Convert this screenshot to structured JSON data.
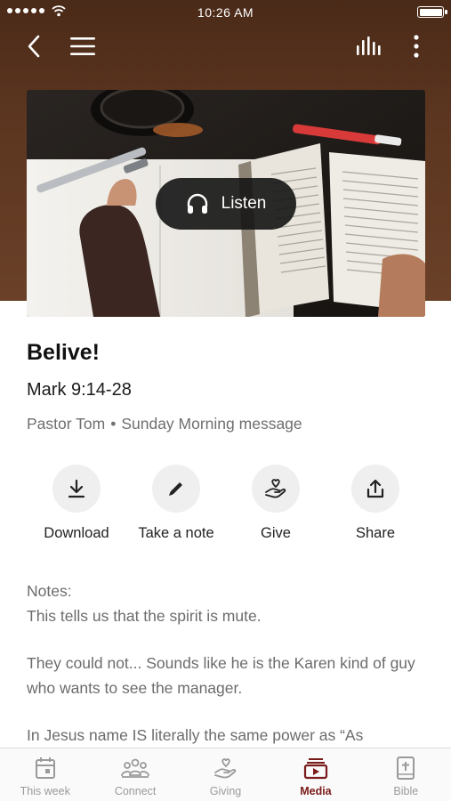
{
  "status_bar": {
    "time": "10:26 AM"
  },
  "header": {
    "back_icon": "chevron-left-icon",
    "menu_icon": "hamburger-menu-icon",
    "audio_icon": "audio-bars-icon",
    "more_icon": "more-vertical-icon"
  },
  "cover": {
    "listen_label": "Listen",
    "listen_icon": "headphones-icon"
  },
  "sermon": {
    "title": "Belive!",
    "scripture": "Mark 9:14-28",
    "speaker": "Pastor Tom",
    "separator": "•",
    "service": "Sunday Morning message"
  },
  "actions": [
    {
      "label": "Download",
      "icon": "download-icon"
    },
    {
      "label": "Take a note",
      "icon": "pencil-icon"
    },
    {
      "label": "Give",
      "icon": "give-hand-heart-icon"
    },
    {
      "label": "Share",
      "icon": "share-icon"
    }
  ],
  "notes": {
    "heading": "Notes:",
    "paragraphs": [
      "This tells us that the spirit is mute.",
      "They could not...   Sounds like he is the Karen kind of guy who wants to see the manager.",
      "In Jesus name IS literally the same power as “As"
    ]
  },
  "tabs": [
    {
      "label": "This week",
      "icon": "calendar-icon",
      "active": false
    },
    {
      "label": "Connect",
      "icon": "people-icon",
      "active": false
    },
    {
      "label": "Giving",
      "icon": "giving-hand-icon",
      "active": false
    },
    {
      "label": "Media",
      "icon": "media-play-icon",
      "active": true
    },
    {
      "label": "Bible",
      "icon": "bible-icon",
      "active": false
    }
  ],
  "colors": {
    "hero_brown": "#5c3620",
    "active_tab": "#7a1a1a",
    "muted_text": "#6c6c6c"
  }
}
